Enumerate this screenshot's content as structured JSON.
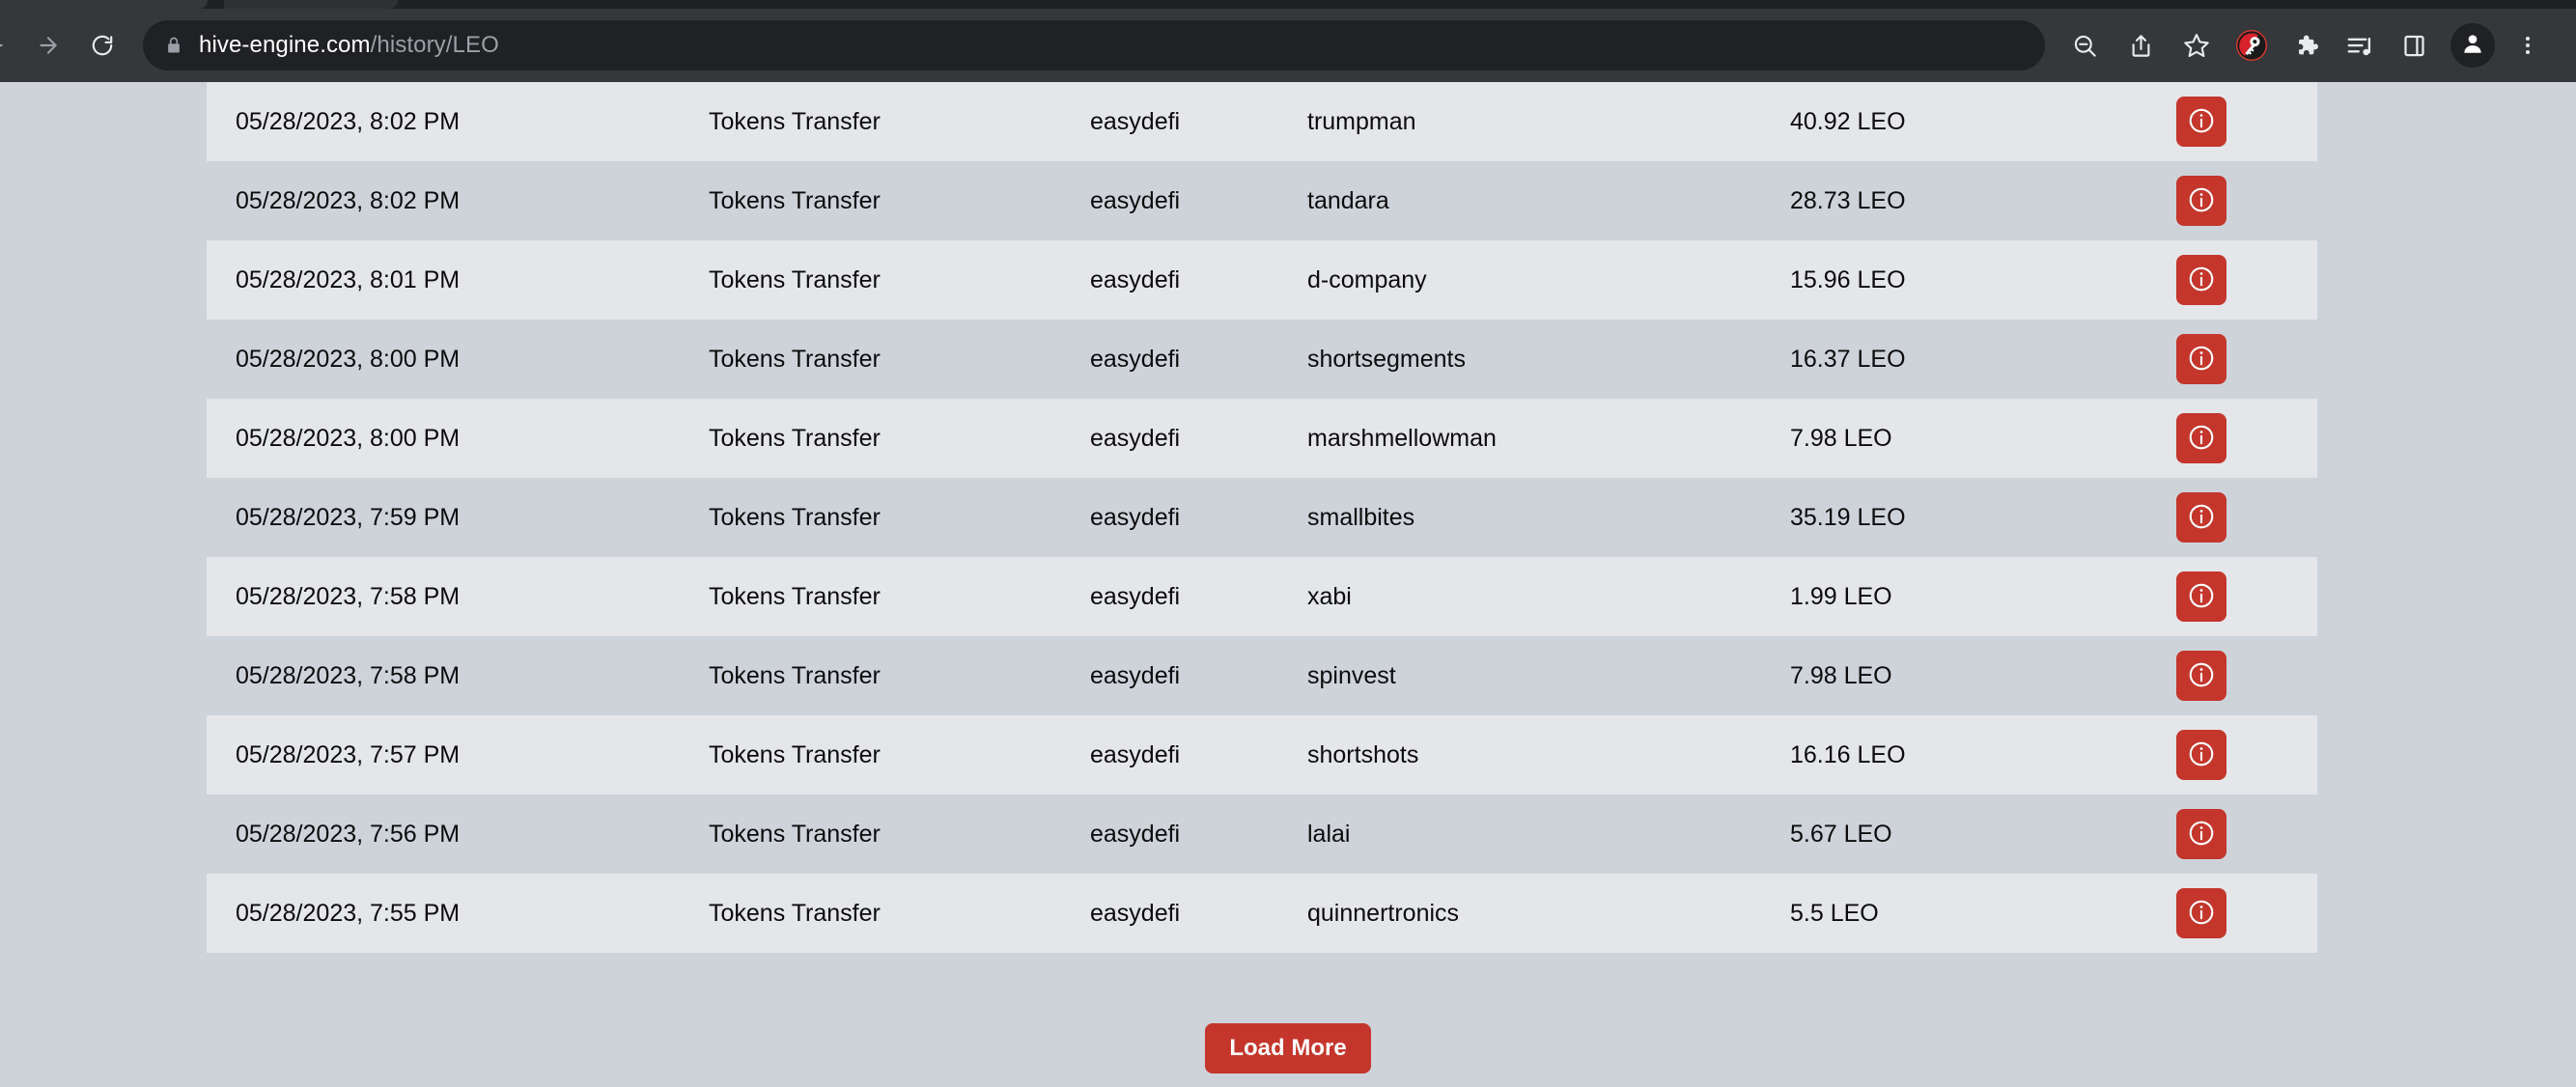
{
  "browser": {
    "url_domain": "hive-engine.com",
    "url_path": "/history/LEO",
    "nav": {
      "back": "back-arrow",
      "forward": "forward-arrow",
      "reload": "reload"
    },
    "omnibox_icons": {
      "lock": "lock-icon",
      "zoom_out": "zoom-out-icon",
      "share": "share-icon",
      "bookmark": "bookmark-star-icon"
    },
    "extension_icons": {
      "keychain": "hive-keychain-extension-icon",
      "puzzle": "extensions-puzzle-icon",
      "media": "media-playlist-icon",
      "side_panel": "side-panel-icon",
      "profile": "profile-avatar-icon",
      "menu": "three-dot-menu-icon"
    }
  },
  "page": {
    "background_color": "#ced3da",
    "row_color_odd": "#e4e6ea",
    "row_color_even": "#ced3da",
    "accent_color": "#c4362c",
    "load_more_label": "Load More",
    "info_icon": "info-circle-icon",
    "rows": [
      {
        "date": "05/28/2023, 8:02 PM",
        "type": "Tokens Transfer",
        "from": "easydefi",
        "to": "trumpman",
        "amount": "40.92 LEO"
      },
      {
        "date": "05/28/2023, 8:02 PM",
        "type": "Tokens Transfer",
        "from": "easydefi",
        "to": "tandara",
        "amount": "28.73 LEO"
      },
      {
        "date": "05/28/2023, 8:01 PM",
        "type": "Tokens Transfer",
        "from": "easydefi",
        "to": "d-company",
        "amount": "15.96 LEO"
      },
      {
        "date": "05/28/2023, 8:00 PM",
        "type": "Tokens Transfer",
        "from": "easydefi",
        "to": "shortsegments",
        "amount": "16.37 LEO"
      },
      {
        "date": "05/28/2023, 8:00 PM",
        "type": "Tokens Transfer",
        "from": "easydefi",
        "to": "marshmellowman",
        "amount": "7.98 LEO"
      },
      {
        "date": "05/28/2023, 7:59 PM",
        "type": "Tokens Transfer",
        "from": "easydefi",
        "to": "smallbites",
        "amount": "35.19 LEO"
      },
      {
        "date": "05/28/2023, 7:58 PM",
        "type": "Tokens Transfer",
        "from": "easydefi",
        "to": "xabi",
        "amount": "1.99 LEO"
      },
      {
        "date": "05/28/2023, 7:58 PM",
        "type": "Tokens Transfer",
        "from": "easydefi",
        "to": "spinvest",
        "amount": "7.98 LEO"
      },
      {
        "date": "05/28/2023, 7:57 PM",
        "type": "Tokens Transfer",
        "from": "easydefi",
        "to": "shortshots",
        "amount": "16.16 LEO"
      },
      {
        "date": "05/28/2023, 7:56 PM",
        "type": "Tokens Transfer",
        "from": "easydefi",
        "to": "lalai",
        "amount": "5.67 LEO"
      },
      {
        "date": "05/28/2023, 7:55 PM",
        "type": "Tokens Transfer",
        "from": "easydefi",
        "to": "quinnertronics",
        "amount": "5.5 LEO"
      }
    ]
  }
}
